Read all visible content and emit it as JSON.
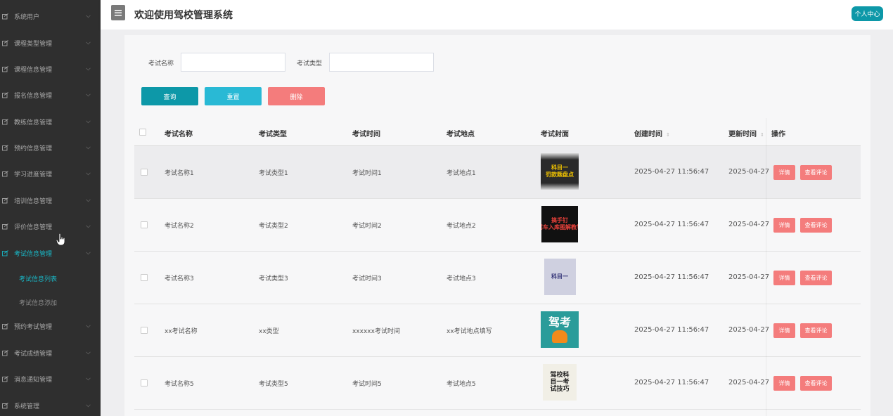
{
  "sidebar": {
    "items": [
      {
        "label": "系统用户"
      },
      {
        "label": "课程类型管理"
      },
      {
        "label": "课程信息管理"
      },
      {
        "label": "报名信息管理"
      },
      {
        "label": "教练信息管理"
      },
      {
        "label": "预约信息管理"
      },
      {
        "label": "学习进度管理"
      },
      {
        "label": "培训信息管理"
      },
      {
        "label": "评价信息管理"
      },
      {
        "label": "考试信息管理"
      },
      {
        "label": "预约考试管理"
      },
      {
        "label": "考试成绩管理"
      },
      {
        "label": "消息通知管理"
      },
      {
        "label": "系统管理"
      }
    ],
    "subitems": [
      {
        "label": "考试信息列表"
      },
      {
        "label": "考试信息添加"
      }
    ]
  },
  "header": {
    "title": "欢迎使用驾校管理系统",
    "profile_label": "个人中心"
  },
  "search": {
    "name_label": "考试名称",
    "name_value": "",
    "type_label": "考试类型",
    "type_value": ""
  },
  "buttons": {
    "query": "查询",
    "reset": "重置",
    "delete": "删除"
  },
  "colors": {
    "query": "#0d98a8",
    "reset": "#29b9d5",
    "delete": "#f47c7c",
    "active_menu": "#19b7c6"
  },
  "table": {
    "headers": [
      "考试名称",
      "考试类型",
      "考试时间",
      "考试地点",
      "考试封面",
      "创建时间",
      "更新时间",
      "操作"
    ],
    "rows": [
      {
        "name": "考试名称1",
        "type": "考试类型1",
        "time": "考试时间1",
        "place": "考试地点1",
        "created": "2025-04-27 11:56:47",
        "updated": "2025-04-27",
        "cover_text": [
          "科目一",
          "罚款题盘点"
        ]
      },
      {
        "name": "考试名称2",
        "type": "考试类型2",
        "time": "考试时间2",
        "place": "考试地点2",
        "created": "2025-04-27 11:56:47",
        "updated": "2025-04-27",
        "cover_text": [
          "搞手钉",
          "驾车入库图解教学"
        ]
      },
      {
        "name": "考试名称3",
        "type": "考试类型3",
        "time": "考试时间3",
        "place": "考试地点3",
        "created": "2025-04-27 11:56:47",
        "updated": "2025-04-27",
        "cover_text": [
          "科目一"
        ]
      },
      {
        "name": "xx考试名称",
        "type": "xx类型",
        "time": "xxxxxx考试时间",
        "place": "xx考试地点填写",
        "created": "2025-04-27 11:56:47",
        "updated": "2025-04-27",
        "cover_text": [
          "驾考"
        ]
      },
      {
        "name": "考试名称5",
        "type": "考试类型5",
        "time": "考试时间5",
        "place": "考试地点5",
        "created": "2025-04-27 11:56:47",
        "updated": "2025-04-27",
        "cover_text": [
          "驾校科",
          "目一考",
          "试技巧"
        ]
      }
    ],
    "ops": {
      "detail": "详情",
      "comments": "查看评论"
    }
  }
}
